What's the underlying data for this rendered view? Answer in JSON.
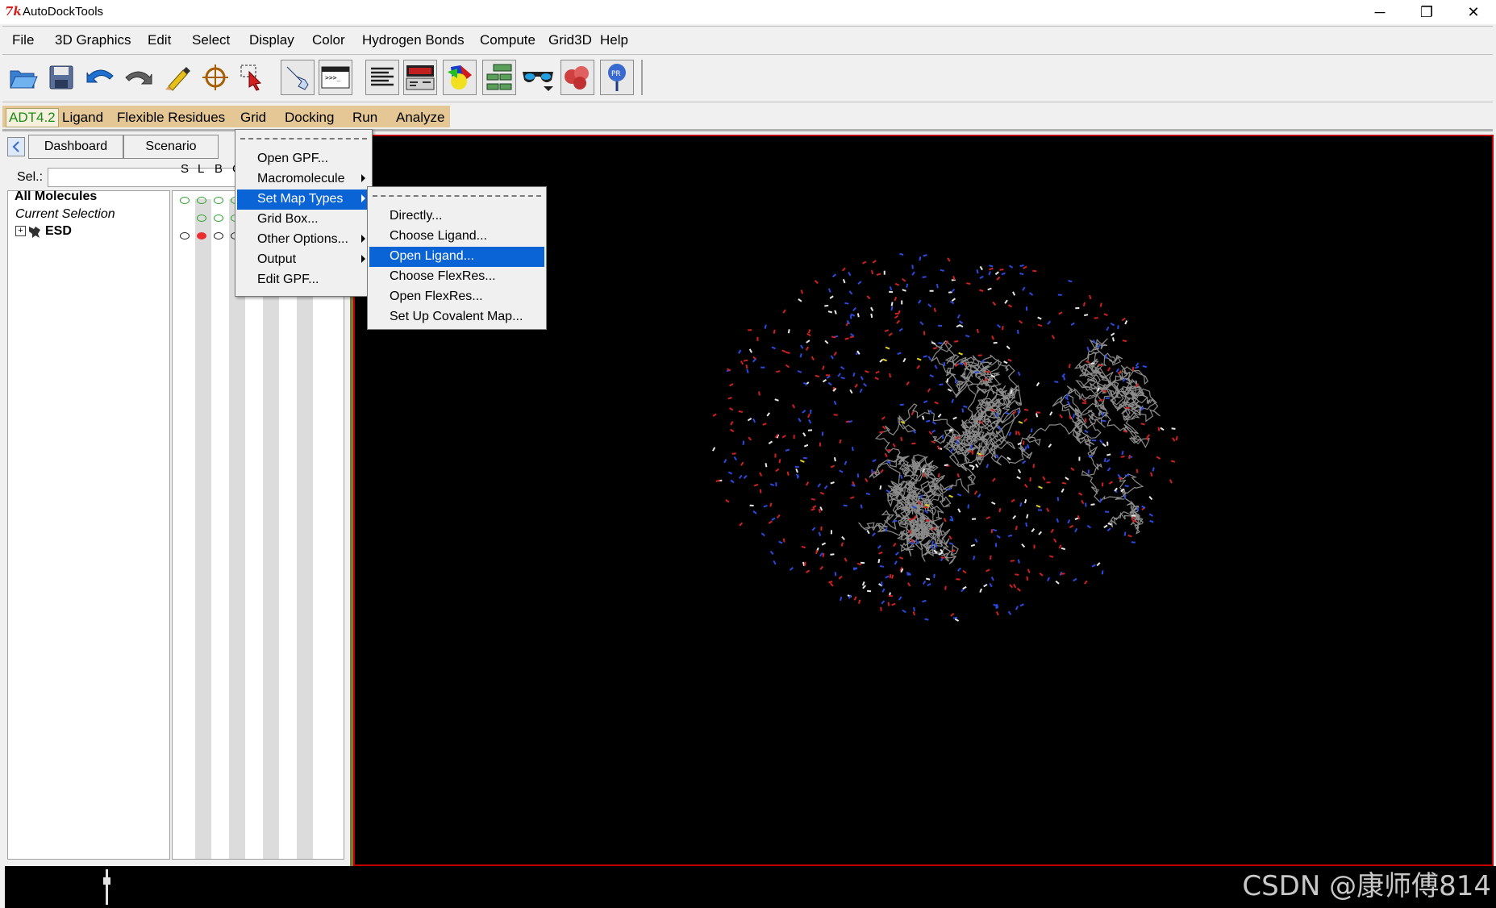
{
  "window": {
    "title": "AutoDockTools",
    "logo_text": "7k",
    "controls": {
      "minimize": "─",
      "restore": "❐",
      "close": "✕"
    }
  },
  "menubar": [
    "File",
    "3D Graphics",
    "Edit",
    "Select",
    "Display",
    "Color",
    "Hydrogen Bonds",
    "Compute",
    "Grid3D",
    "Help"
  ],
  "toolbar_icons": [
    "open-folder-icon",
    "save-disk-icon",
    "undo-arrow-icon",
    "redo-arrow-icon",
    "pencil-icon",
    "crosshair-icon",
    "select-pick-icon",
    "hand-pointer-icon",
    "python-shell-icon",
    "text-lines-icon",
    "dashboard-monitor-icon",
    "color-spheres-icon",
    "tree-structure-icon",
    "3d-glasses-icon",
    "molecule-surface-icon",
    "pmv-balloon-icon"
  ],
  "adt_bar": [
    "ADT4.2",
    "Ligand",
    "Flexible Residues",
    "Grid",
    "Docking",
    "Run",
    "Analyze"
  ],
  "left_panel": {
    "tabs": [
      "Dashboard",
      "Scenario"
    ],
    "sel_label": "Sel.:",
    "sel_value": "",
    "tree": {
      "all_molecules": "All Molecules",
      "current_selection": "Current Selection",
      "molecule": "ESD"
    },
    "columns": [
      "S",
      "L",
      "B",
      "C"
    ]
  },
  "grid_menu": {
    "items": [
      {
        "label": "Open GPF...",
        "submenu": false
      },
      {
        "label": "Macromolecule",
        "submenu": true
      },
      {
        "label": "Set Map Types",
        "submenu": true,
        "active": true
      },
      {
        "label": "Grid Box...",
        "submenu": false
      },
      {
        "label": "Other Options...",
        "submenu": true
      },
      {
        "label": "Output",
        "submenu": true
      },
      {
        "label": "Edit GPF...",
        "submenu": false
      }
    ]
  },
  "map_types_submenu": {
    "items": [
      {
        "label": "Directly..."
      },
      {
        "label": "Choose Ligand..."
      },
      {
        "label": "Open Ligand...",
        "active": true
      },
      {
        "label": "Choose FlexRes..."
      },
      {
        "label": "Open FlexRes..."
      },
      {
        "label": "Set Up Covalent Map..."
      }
    ]
  },
  "colors": {
    "viewer_background": "#000000",
    "viewer_border": "#c00000",
    "menu_highlight": "#0a64d6",
    "adt_bar": "#e4c794",
    "adt_active_text": "#1a8a1a"
  },
  "watermark": "CSDN @康师傅814"
}
